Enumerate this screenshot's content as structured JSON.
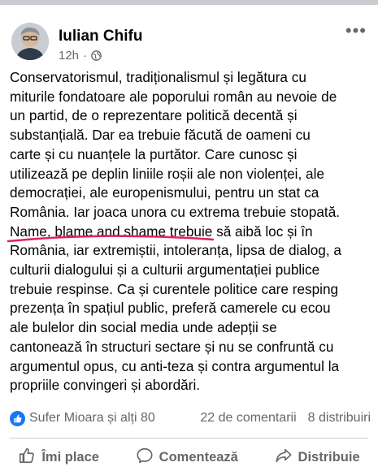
{
  "post": {
    "author": "Iulian Chifu",
    "time": "12h",
    "dot": "·",
    "more": "•••",
    "text": "Conservatorismul, tradiționalismul și legătura cu\nmiturile fondatoare ale poporului român au nevoie de\nun partid, de o reprezentare politică decentă și\nsubstanțială. Dar ea trebuie făcută de oameni cu\ncarte și cu nuanțele la purtător. Care cunosc și\nutilizează pe deplin liniile roșii ale non violenței, ale\ndemocrației, ale europenismului, pentru un stat ca\nRomânia. Iar joaca unora cu extrema trebuie stopată.\nName, blame and shame trebuie să aibă loc și în\nRomânia, iar extremiștii, intoleranța, lipsa de dialog, a\nculturii dialogului și a culturii argumentației publice\ntrebuie respinse. Ca și curentele politice care resping\nprezența în spațiul public, preferă camerele cu ecou\nale bulelor din social media unde adepții se\ncantonează în structuri sectare și nu se confruntă cu\nargumentul opus, cu anti-teza și contra argumentul la\npropriile convingeri și abordări."
  },
  "stats": {
    "reactions": "Sufer Mioara și alți 80",
    "comments": "22 de comentarii",
    "shares": "8 distribuiri"
  },
  "actions": {
    "like": "Îmi place",
    "comment": "Comentează",
    "share": "Distribuie"
  },
  "colors": {
    "accent": "#1877f2",
    "annotation": "#e0245e",
    "muted": "#65676b"
  },
  "icons": [
    "globe-icon",
    "like-icon",
    "comment-icon",
    "share-icon",
    "more-icon"
  ]
}
